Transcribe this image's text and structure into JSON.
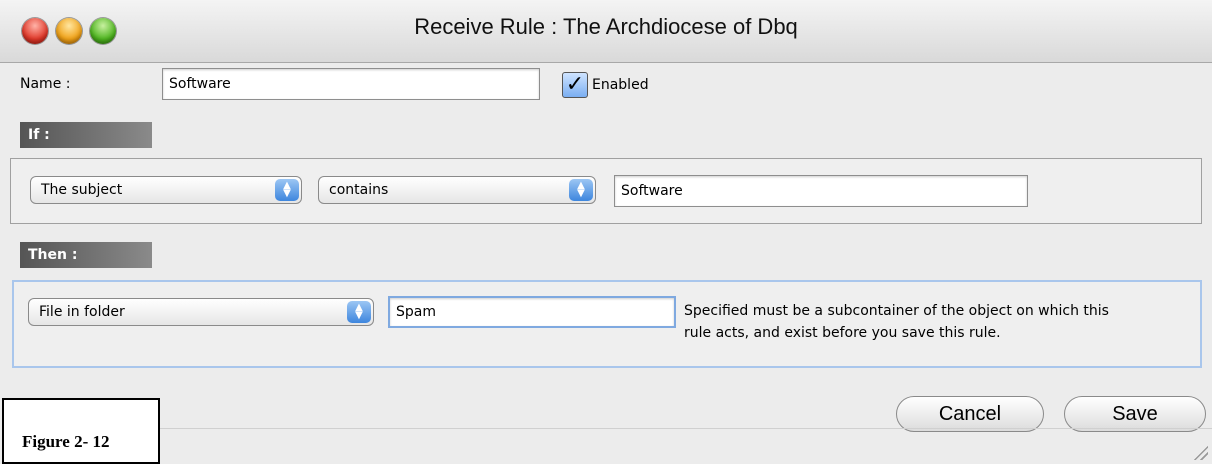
{
  "window": {
    "title": "Receive Rule : The Archdiocese of Dbq"
  },
  "name_row": {
    "label": "Name :",
    "value": "Software",
    "enabled_label": "Enabled",
    "enabled_checked": true
  },
  "if_section": {
    "header": "If :",
    "field_popup": "The subject",
    "operator_popup": "contains",
    "value": "Software"
  },
  "then_section": {
    "header": "Then :",
    "action_popup": "File in folder",
    "folder_value": "Spam",
    "help_line1": "Specified must be a subcontainer of the object on which this",
    "help_line2": "rule acts, and  exist before you save this rule."
  },
  "buttons": {
    "cancel": "Cancel",
    "save": "Save"
  },
  "figure_caption": "Figure 2- 12"
}
